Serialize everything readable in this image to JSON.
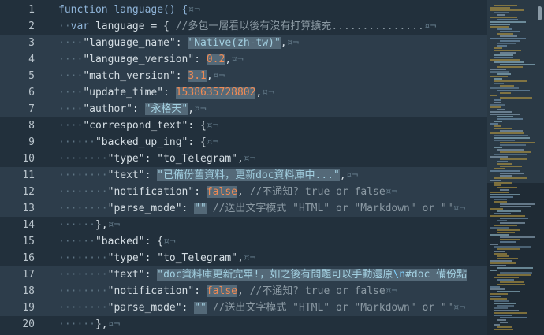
{
  "editor": {
    "lines": [
      {
        "n": "1",
        "tokens": [
          [
            "kw",
            "function language() {"
          ],
          [
            "ws",
            "¤¬"
          ]
        ]
      },
      {
        "n": "2",
        "tokens": [
          [
            "ws",
            "··"
          ],
          [
            "kw",
            "var"
          ],
          [
            "t",
            " language = { "
          ],
          [
            "com",
            "//多包一層看以後有沒有打算擴充..............."
          ],
          [
            "ws",
            "¤¬"
          ]
        ]
      },
      {
        "n": "3",
        "tokens": [
          [
            "ws",
            "····"
          ],
          [
            "t",
            "\"language_name\": "
          ],
          [
            "strbox",
            "\"Native(zh-tw)\""
          ],
          [
            "t",
            ","
          ],
          [
            "ws",
            "¤¬"
          ]
        ]
      },
      {
        "n": "4",
        "tokens": [
          [
            "ws",
            "····"
          ],
          [
            "t",
            "\"language_version\": "
          ],
          [
            "numbox",
            "0.2"
          ],
          [
            "t",
            ","
          ],
          [
            "ws",
            "¤¬"
          ]
        ]
      },
      {
        "n": "5",
        "tokens": [
          [
            "ws",
            "····"
          ],
          [
            "t",
            "\"match_version\": "
          ],
          [
            "numbox",
            "3.1"
          ],
          [
            "t",
            ","
          ],
          [
            "ws",
            "¤¬"
          ]
        ]
      },
      {
        "n": "6",
        "tokens": [
          [
            "ws",
            "····"
          ],
          [
            "t",
            "\"update_time\": "
          ],
          [
            "numbox",
            "1538635728802"
          ],
          [
            "t",
            ","
          ],
          [
            "ws",
            "¤¬"
          ]
        ]
      },
      {
        "n": "7",
        "tokens": [
          [
            "ws",
            "····"
          ],
          [
            "t",
            "\"author\": "
          ],
          [
            "strbox",
            "\"永格天\""
          ],
          [
            "t",
            ","
          ],
          [
            "ws",
            "¤¬"
          ]
        ]
      },
      {
        "n": "8",
        "tokens": [
          [
            "ws",
            "····"
          ],
          [
            "t",
            "\"correspond_text\": {"
          ],
          [
            "ws",
            "¤¬"
          ]
        ]
      },
      {
        "n": "9",
        "tokens": [
          [
            "ws",
            "······"
          ],
          [
            "t",
            "\"backed_up_ing\": {"
          ],
          [
            "ws",
            "¤¬"
          ]
        ]
      },
      {
        "n": "10",
        "tokens": [
          [
            "ws",
            "········"
          ],
          [
            "t",
            "\"type\": \"to_Telegram\","
          ],
          [
            "ws",
            "¤¬"
          ]
        ]
      },
      {
        "n": "11",
        "tokens": [
          [
            "ws",
            "········"
          ],
          [
            "t",
            "\"text\": "
          ],
          [
            "strbox",
            "\"已備份舊資料，更新doc資料庫中...\""
          ],
          [
            "t",
            ","
          ],
          [
            "ws",
            "¤¬"
          ]
        ]
      },
      {
        "n": "12",
        "tokens": [
          [
            "ws",
            "········"
          ],
          [
            "t",
            "\"notification\": "
          ],
          [
            "numbox",
            "false"
          ],
          [
            "t",
            ", "
          ],
          [
            "com",
            "//不通知? true or false"
          ],
          [
            "ws",
            "¤¬"
          ]
        ]
      },
      {
        "n": "13",
        "tokens": [
          [
            "ws",
            "········"
          ],
          [
            "t",
            "\"parse_mode\": "
          ],
          [
            "strbox",
            "\"\""
          ],
          [
            "t",
            " "
          ],
          [
            "com",
            "//送出文字模式 \"HTML\" or \"Markdown\" or \"\""
          ],
          [
            "ws",
            "¤¬"
          ]
        ]
      },
      {
        "n": "14",
        "tokens": [
          [
            "ws",
            "······"
          ],
          [
            "t",
            "},"
          ],
          [
            "ws",
            "¤¬"
          ]
        ]
      },
      {
        "n": "15",
        "tokens": [
          [
            "ws",
            "······"
          ],
          [
            "t",
            "\"backed\": {"
          ],
          [
            "ws",
            "¤¬"
          ]
        ]
      },
      {
        "n": "16",
        "tokens": [
          [
            "ws",
            "········"
          ],
          [
            "t",
            "\"type\": \"to_Telegram\","
          ],
          [
            "ws",
            "¤¬"
          ]
        ]
      },
      {
        "n": "17",
        "tokens": [
          [
            "ws",
            "········"
          ],
          [
            "t",
            "\"text\": "
          ],
          [
            "strbox",
            "\"doc資料庫更新完畢!，如之後有問題可以手動還原"
          ],
          [
            "escbox",
            "\\n"
          ],
          [
            "strbox",
            "#doc 備份點"
          ]
        ]
      },
      {
        "n": "18",
        "tokens": [
          [
            "ws",
            "········"
          ],
          [
            "t",
            "\"notification\": "
          ],
          [
            "numbox",
            "false"
          ],
          [
            "t",
            ", "
          ],
          [
            "com",
            "//不通知? true or false"
          ],
          [
            "ws",
            "¤¬"
          ]
        ]
      },
      {
        "n": "19",
        "tokens": [
          [
            "ws",
            "········"
          ],
          [
            "t",
            "\"parse_mode\": "
          ],
          [
            "strbox",
            "\"\""
          ],
          [
            "t",
            " "
          ],
          [
            "com",
            "//送出文字模式 \"HTML\" or \"Markdown\" or \"\""
          ],
          [
            "ws",
            "¤¬"
          ]
        ]
      },
      {
        "n": "20",
        "tokens": [
          [
            "ws",
            "······"
          ],
          [
            "t",
            "},"
          ],
          [
            "ws",
            "¤¬"
          ]
        ]
      }
    ],
    "highlighted_lines": [
      "3",
      "4",
      "5",
      "6",
      "7",
      "11",
      "12",
      "13",
      "17",
      "18",
      "19"
    ]
  }
}
